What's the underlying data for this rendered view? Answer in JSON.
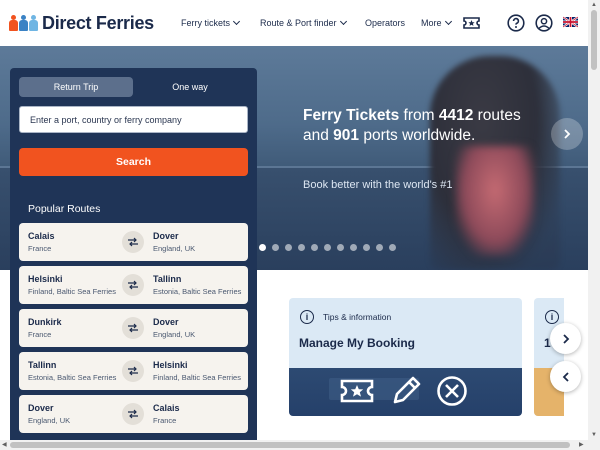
{
  "brand": {
    "name": "Direct Ferries",
    "colors": {
      "navy": "#1b2a4a",
      "orange": "#f1531f",
      "panel": "#1f3457",
      "card": "#dbe9f5"
    }
  },
  "nav": {
    "items": [
      {
        "label": "Ferry tickets",
        "has_dropdown": true
      },
      {
        "label": "Route & Port finder",
        "has_dropdown": true
      },
      {
        "label": "Operators",
        "has_dropdown": false
      },
      {
        "label": "More",
        "has_dropdown": true
      }
    ],
    "icons": [
      "ticket-icon",
      "help-icon",
      "account-icon",
      "uk-flag-icon"
    ]
  },
  "hero": {
    "title_parts": [
      "Ferry Tickets",
      " from ",
      "4412",
      " routes and ",
      "901",
      " ports worldwide."
    ],
    "subtitle": "Book better with the world's #1",
    "slide_count": 11,
    "active_slide": 1
  },
  "search": {
    "trip_types": [
      "Return Trip",
      "One way"
    ],
    "selected_trip_type": "Return Trip",
    "input_placeholder": "Enter a port, country or ferry company",
    "button_label": "Search"
  },
  "popular": {
    "title": "Popular Routes",
    "routes": [
      {
        "from_city": "Calais",
        "from_country": "France",
        "to_city": "Dover",
        "to_country": "England, UK"
      },
      {
        "from_city": "Helsinki",
        "from_country": "Finland, Baltic Sea Ferries",
        "to_city": "Tallinn",
        "to_country": "Estonia, Baltic Sea Ferries"
      },
      {
        "from_city": "Dunkirk",
        "from_country": "France",
        "to_city": "Dover",
        "to_country": "England, UK"
      },
      {
        "from_city": "Tallinn",
        "from_country": "Estonia, Baltic Sea Ferries",
        "to_city": "Helsinki",
        "to_country": "Finland, Baltic Sea Ferries"
      },
      {
        "from_city": "Dover",
        "from_country": "England, UK",
        "to_city": "Calais",
        "to_country": "France"
      }
    ]
  },
  "cards": [
    {
      "kicker": "Tips & information",
      "title": "Manage My Booking"
    }
  ],
  "card_peek": {
    "title_fragment": "1"
  }
}
